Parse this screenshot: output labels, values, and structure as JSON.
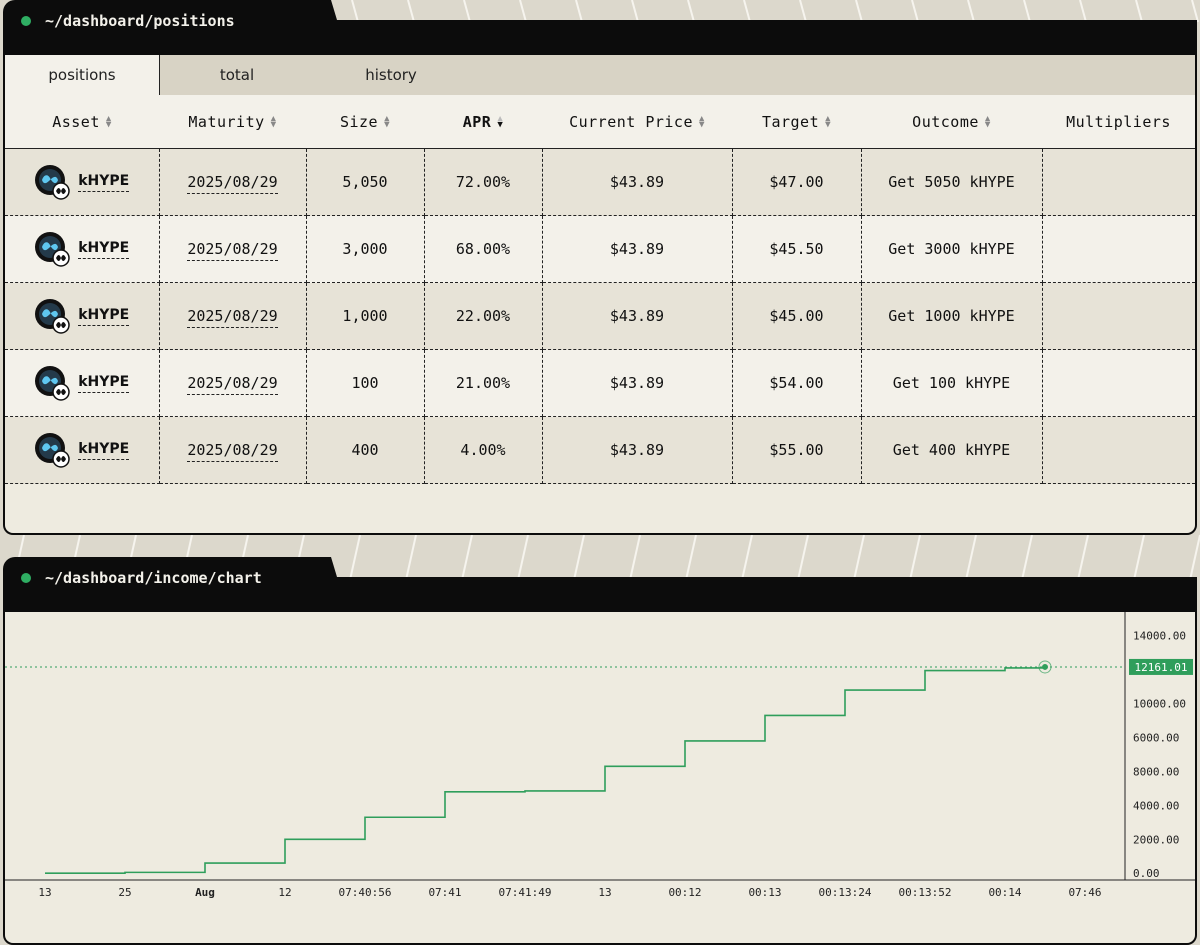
{
  "positions_panel": {
    "title": "~/dashboard/positions",
    "tabs": [
      {
        "label": "positions",
        "active": true
      },
      {
        "label": "total",
        "active": false
      },
      {
        "label": "history",
        "active": false
      }
    ],
    "columns": [
      {
        "label": "Asset",
        "sort": "both"
      },
      {
        "label": "Maturity",
        "sort": "both"
      },
      {
        "label": "Size",
        "sort": "both"
      },
      {
        "label": "APR",
        "sort": "desc"
      },
      {
        "label": "Current Price",
        "sort": "both"
      },
      {
        "label": "Target",
        "sort": "both"
      },
      {
        "label": "Outcome",
        "sort": "both"
      },
      {
        "label": "Multipliers",
        "sort": "none"
      }
    ],
    "rows": [
      {
        "asset": "kHYPE",
        "maturity": "2025/08/29",
        "size": "5,050",
        "apr": "72.00%",
        "price": "$43.89",
        "target": "$47.00",
        "outcome": "Get 5050 kHYPE",
        "multipliers": ""
      },
      {
        "asset": "kHYPE",
        "maturity": "2025/08/29",
        "size": "3,000",
        "apr": "68.00%",
        "price": "$43.89",
        "target": "$45.50",
        "outcome": "Get 3000 kHYPE",
        "multipliers": ""
      },
      {
        "asset": "kHYPE",
        "maturity": "2025/08/29",
        "size": "1,000",
        "apr": "22.00%",
        "price": "$43.89",
        "target": "$45.00",
        "outcome": "Get 1000 kHYPE",
        "multipliers": ""
      },
      {
        "asset": "kHYPE",
        "maturity": "2025/08/29",
        "size": "100",
        "apr": "21.00%",
        "price": "$43.89",
        "target": "$54.00",
        "outcome": "Get 100 kHYPE",
        "multipliers": ""
      },
      {
        "asset": "kHYPE",
        "maturity": "2025/08/29",
        "size": "400",
        "apr": "4.00%",
        "price": "$43.89",
        "target": "$55.00",
        "outcome": "Get 400 kHYPE",
        "multipliers": ""
      }
    ]
  },
  "income_panel": {
    "title": "~/dashboard/income/chart"
  },
  "colors": {
    "line": "#2f9e5b",
    "status_dot": "#2fae63",
    "header_bg": "#0c0c0c",
    "panel_bg": "#eeebe0"
  },
  "chart_data": {
    "type": "line",
    "step": true,
    "x_tick_labels": [
      "13",
      "25",
      "Aug",
      "12",
      "07:40:56",
      "07:41",
      "07:41:49",
      "13",
      "00:12",
      "00:13",
      "00:13:24",
      "00:13:52",
      "00:14",
      "07:46"
    ],
    "x_bold_ticks": [
      "Aug"
    ],
    "y_tick_labels": [
      "0.00",
      "2000.00",
      "4000.00",
      "8000.00",
      "6000.00",
      "10000.00",
      "14000.00"
    ],
    "y_ticks": [
      0,
      2000,
      4000,
      6000,
      8000,
      10000,
      14000
    ],
    "ylim": [
      -400,
      15400
    ],
    "last_value": 12161.01,
    "last_value_label": "12161.01",
    "x_index": [
      0,
      0.5,
      1,
      1.5,
      2,
      2.5,
      3,
      3.5,
      4,
      4.5,
      5,
      5.5,
      6,
      6.5,
      7,
      7.5,
      8,
      8.5,
      9,
      9.5,
      10,
      10.5,
      11,
      11.5,
      12,
      12.5
    ],
    "values": [
      0,
      0,
      50,
      50,
      600,
      600,
      2000,
      2000,
      3300,
      3300,
      4800,
      4800,
      4850,
      4850,
      6300,
      6300,
      7800,
      7800,
      9300,
      9300,
      10800,
      10800,
      11950,
      11950,
      12100,
      12161.01
    ]
  }
}
